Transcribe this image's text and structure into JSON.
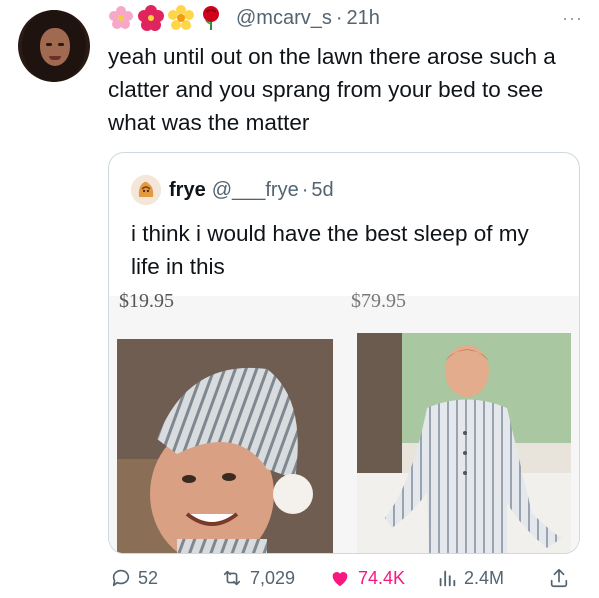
{
  "tweet": {
    "handle": "@mcarv_s",
    "separator": "·",
    "time": "21h",
    "more_label": "···",
    "text": "yeah until out on the lawn there arose such a clatter and you sprang from your bed to see what was the matter",
    "emoji_icons": [
      "cherry-blossom-icon",
      "hibiscus-icon",
      "blossom-icon",
      "rose-icon"
    ]
  },
  "quote": {
    "name": "frye",
    "handle": "@___frye",
    "separator": "·",
    "time": "5d",
    "text": "i think i would have the best sleep of my life in this",
    "price_left": "$19.95",
    "price_right": "$79.95"
  },
  "actions": {
    "replies": "52",
    "reposts": "7,029",
    "likes": "74.4K",
    "views": "2.4M"
  },
  "colors": {
    "handle_gray": "#536471",
    "like_pink": "#f91880",
    "border": "#cfd9de"
  }
}
